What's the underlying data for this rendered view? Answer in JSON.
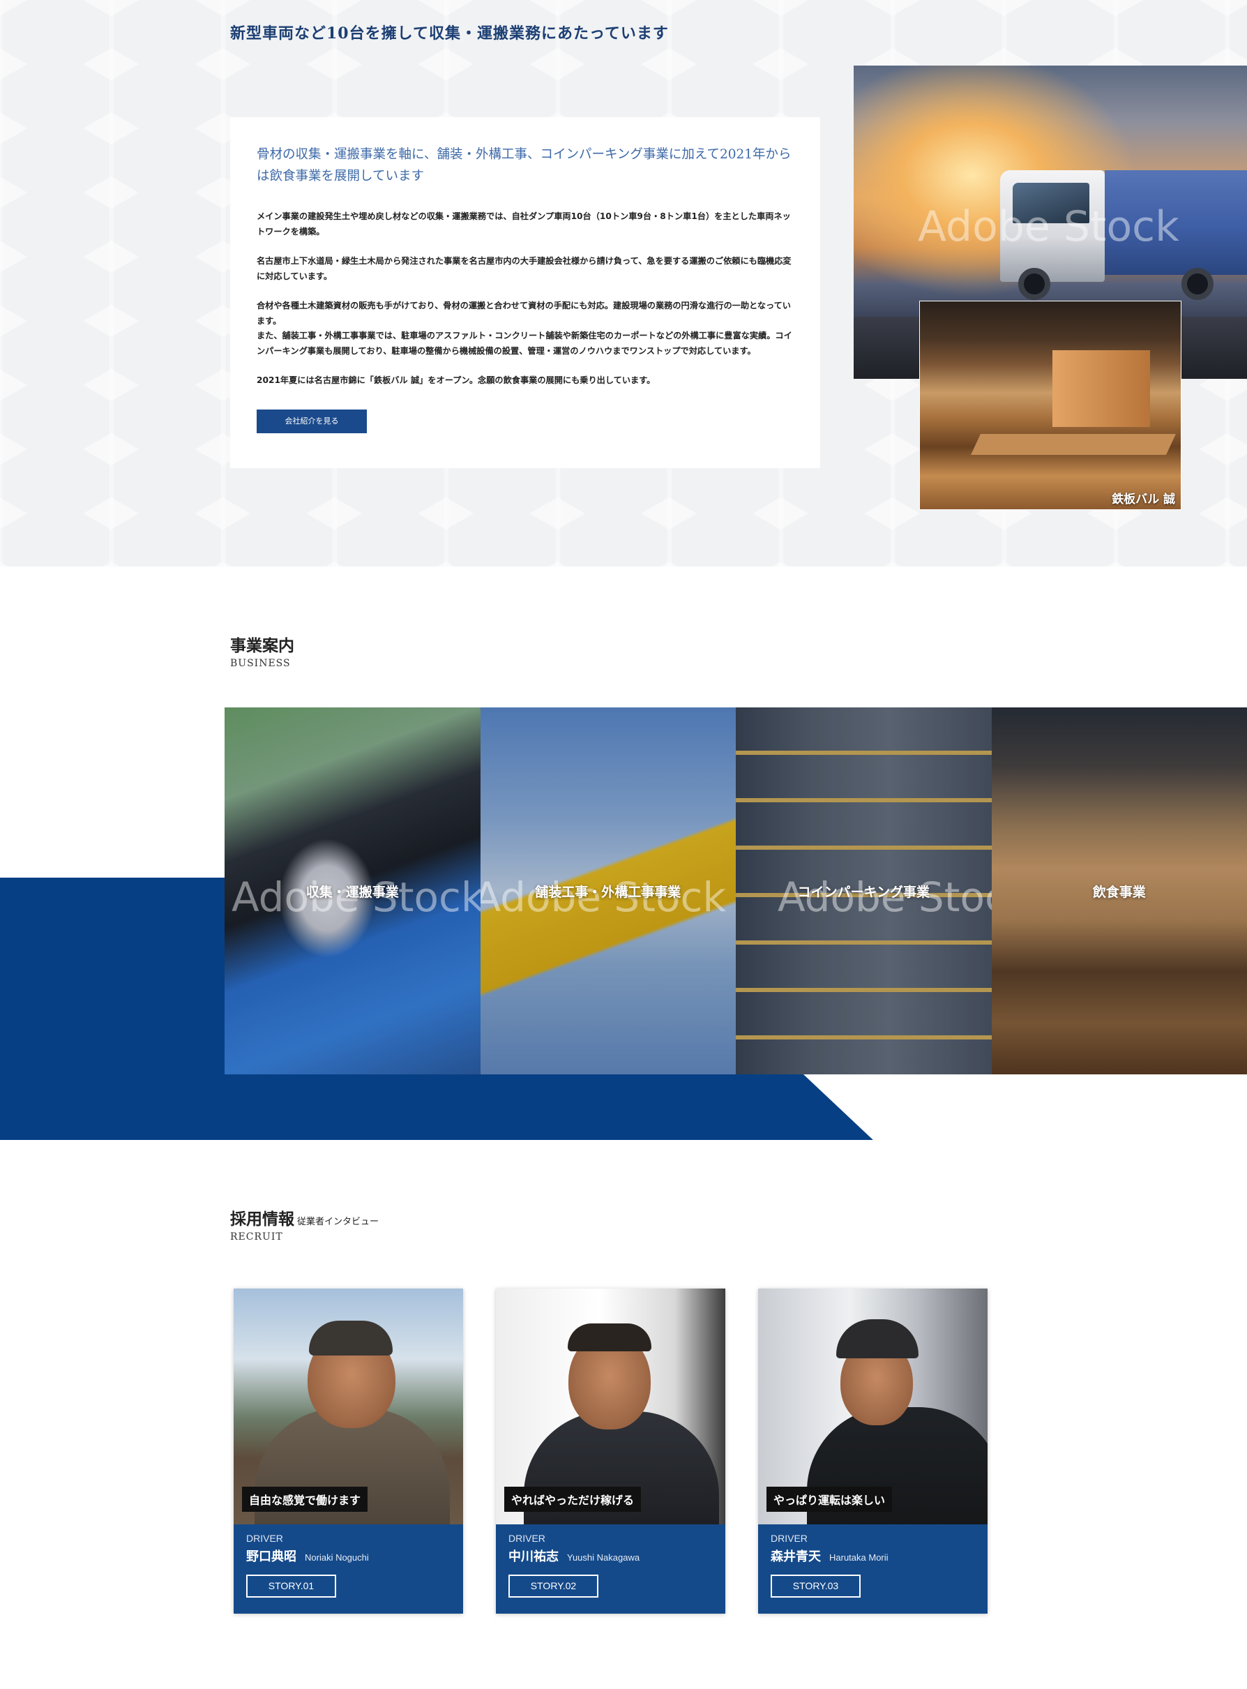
{
  "about": {
    "heading": "新型車両など10台を擁して収集・運搬業務にあたっています",
    "lead": "骨材の収集・運搬事業を軸に、舗装・外構工事、コインパーキング事業に加えて2021年からは飲食事業を展開しています",
    "paragraphs": [
      "メイン事業の建設発生土や埋め戻し材などの収集・運搬業務では、自社ダンプ車両10台（10トン車9台・8トン車1台）を主とした車両ネットワークを構築。",
      "名古屋市上下水道局・緑生土木局から発注された事業を名古屋市内の大手建設会社様から請け負って、急を要する運搬のご依頼にも臨機応変に対応しています。",
      "合材や各種土木建築資材の販売も手がけており、骨材の運搬と合わせて資材の手配にも対応。建設現場の業務の円滑な進行の一助となっています。",
      "また、舗装工事・外構工事事業では、駐車場のアスファルト・コンクリート舗装や新築住宅のカーポートなどの外構工事に豊富な実績。コインパーキング事業も展開しており、駐車場の整備から機械設備の設置、管理・運営のノウハウまでワンストップで対応しています。",
      "2021年夏には名古屋市錦に「鉄板バル 誠」をオープン。念願の飲食事業の展開にも乗り出しています。"
    ],
    "button_label": "会社紹介を見る",
    "photo_caption": "鉄板バル 誠",
    "watermark": "Adobe Stock"
  },
  "business": {
    "title": "事業案内",
    "subtitle": "BUSINESS",
    "tiles": [
      {
        "label": "収集・運搬事業"
      },
      {
        "label": "舗装工事・外構工事事業"
      },
      {
        "label": "コインパーキング事業"
      },
      {
        "label": "飲食事業"
      }
    ]
  },
  "recruit": {
    "title": "採用情報",
    "title_small": "従業者インタビュー",
    "subtitle": "RECRUIT",
    "cards": [
      {
        "catch": "自由な感覚で働けます",
        "role": "DRIVER",
        "name_jp": "野口典昭",
        "name_en": "Noriaki Noguchi",
        "story": "STORY.01"
      },
      {
        "catch": "やればやっただけ稼げる",
        "role": "DRIVER",
        "name_jp": "中川祐志",
        "name_en": "Yuushi Nakagawa",
        "story": "STORY.02"
      },
      {
        "catch": "やっぱり運転は楽しい",
        "role": "DRIVER",
        "name_jp": "森井青天",
        "name_en": "Harutaka Morii",
        "story": "STORY.03"
      }
    ]
  },
  "colors": {
    "brand_blue": "#073f84",
    "card_blue": "#154a8a",
    "heading_blue": "#1c3f73"
  }
}
